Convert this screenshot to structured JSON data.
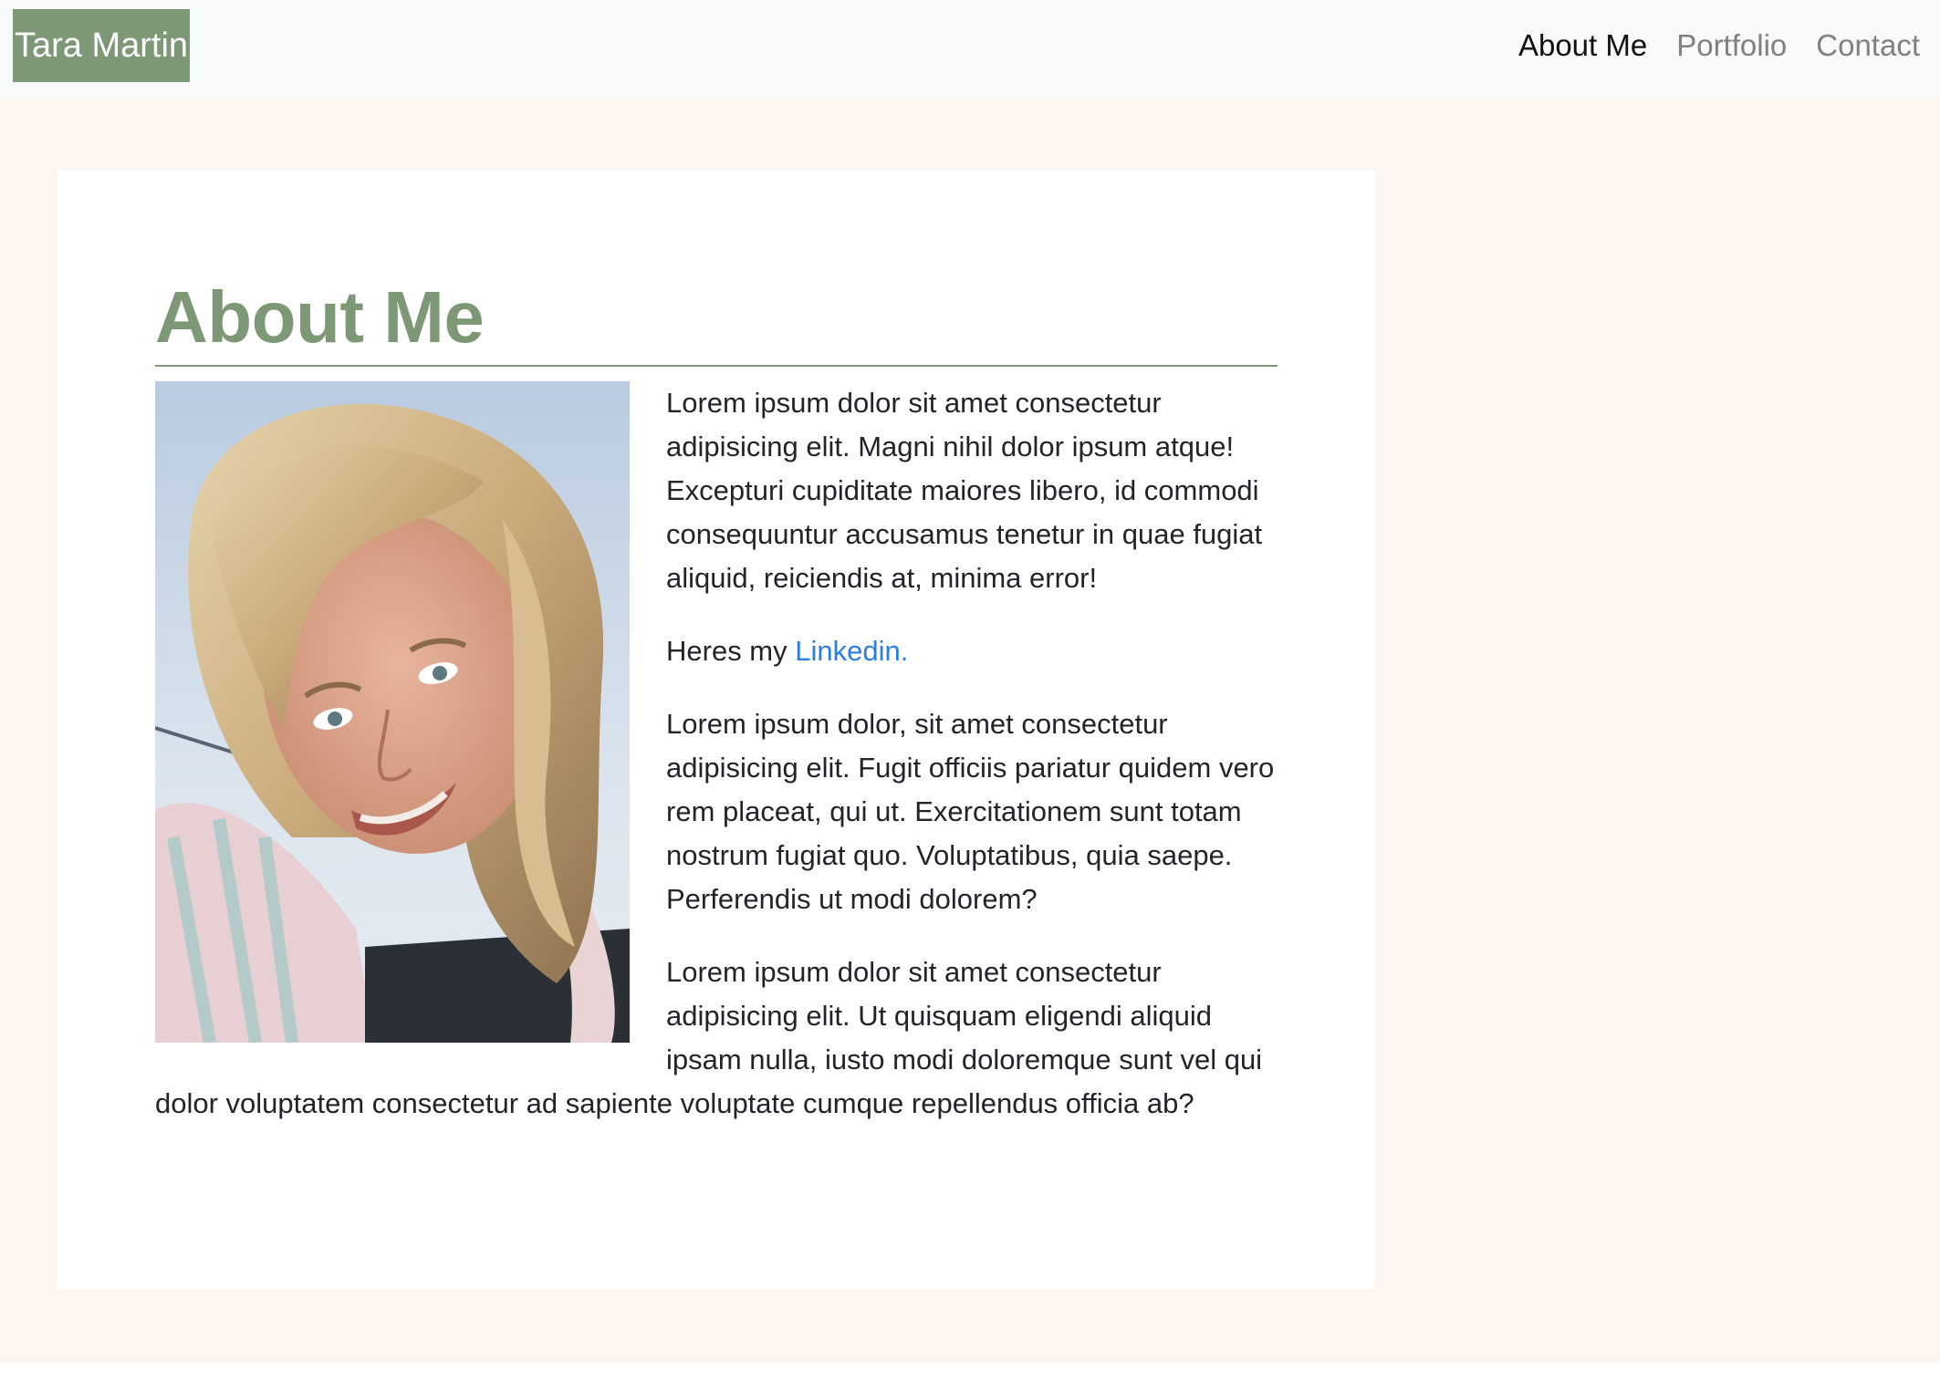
{
  "navbar": {
    "brand": "Tara Martin",
    "links": [
      {
        "label": "About Me",
        "active": true
      },
      {
        "label": "Portfolio",
        "active": false
      },
      {
        "label": "Contact",
        "active": false
      }
    ]
  },
  "about": {
    "title": "About Me",
    "photo_icon": "profile-photo",
    "paragraph1": "Lorem ipsum dolor sit amet consectetur adipisicing elit. Magni nihil dolor ipsum atque! Excepturi cupiditate maiores libero, id commodi consequuntur accusamus tenetur in quae fugiat aliquid, reiciendis at, minima error!",
    "linkedin_prefix": "Heres my ",
    "linkedin_label": "Linkedin.",
    "paragraph2": "Lorem ipsum dolor, sit amet consectetur adipisicing elit. Fugit officiis pariatur quidem vero rem placeat, qui ut. Exercitationem sunt totam nostrum fugiat quo. Voluptatibus, quia saepe. Perferendis ut modi dolorem?",
    "paragraph3": "Lorem ipsum dolor sit amet consectetur adipisicing elit. Ut quisquam eligendi aliquid ipsam nulla, iusto modi doloremque sunt vel qui dolor voluptatem consectetur ad sapiente voluptate cumque repellendus officia ab?"
  },
  "colors": {
    "accent": "#7c9875",
    "page_background": "#fdf5f0",
    "navbar_background": "#f8f9fa",
    "link": "#2b7de3"
  }
}
